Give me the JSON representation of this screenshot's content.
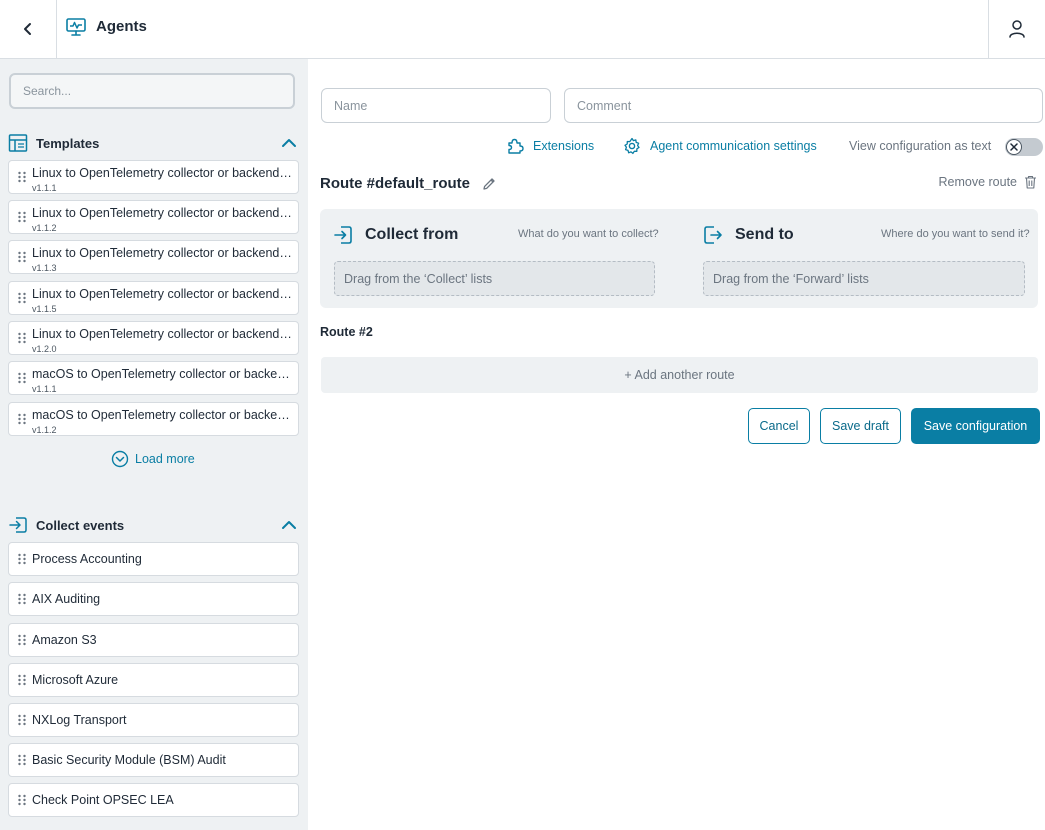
{
  "header": {
    "title": "Agents"
  },
  "sidebar": {
    "search_placeholder": "Search...",
    "templates": {
      "title": "Templates",
      "items": [
        {
          "title": "Linux to OpenTelemetry collector or backend (OTLP)",
          "version": "v1.1.1"
        },
        {
          "title": "Linux to OpenTelemetry collector or backend (OTLP)",
          "version": "v1.1.2"
        },
        {
          "title": "Linux to OpenTelemetry collector or backend (OTLP)",
          "version": "v1.1.3"
        },
        {
          "title": "Linux to OpenTelemetry collector or backend (OTLP)",
          "version": "v1.1.5"
        },
        {
          "title": "Linux to OpenTelemetry collector or backend (OTLP)",
          "version": "v1.2.0"
        },
        {
          "title": "macOS to OpenTelemetry collector or backend (OTLP)",
          "version": "v1.1.1"
        },
        {
          "title": "macOS to OpenTelemetry collector or backend (OTLP)",
          "version": "v1.1.2"
        }
      ],
      "load_more": "Load more"
    },
    "collect_events": {
      "title": "Collect events",
      "items": [
        "Process Accounting",
        "AIX Auditing",
        "Amazon S3",
        "Microsoft Azure",
        "NXLog Transport",
        "Basic Security Module (BSM) Audit",
        "Check Point OPSEC LEA"
      ]
    }
  },
  "main": {
    "name_placeholder": "Name",
    "comment_placeholder": "Comment",
    "extensions_label": "Extensions",
    "comm_settings_label": "Agent communication settings",
    "view_as_text_label": "View configuration as text",
    "view_as_text_on": false,
    "route": {
      "title": "Route #default_route",
      "remove_label": "Remove route",
      "collect": {
        "title": "Collect from",
        "hint": "What do you want to collect?",
        "drop": "Drag from the ‘Collect’ lists"
      },
      "send": {
        "title": "Send to",
        "hint": "Where do you want to send it?",
        "drop": "Drag from the ‘Forward’ lists"
      }
    },
    "route2_title": "Route #2",
    "add_route_label": "+ Add another route",
    "cancel_label": "Cancel",
    "save_draft_label": "Save draft",
    "save_config_label": "Save configuration"
  },
  "colors": {
    "accent": "#0a7ea4",
    "sidebar_bg": "#eef1f3"
  }
}
